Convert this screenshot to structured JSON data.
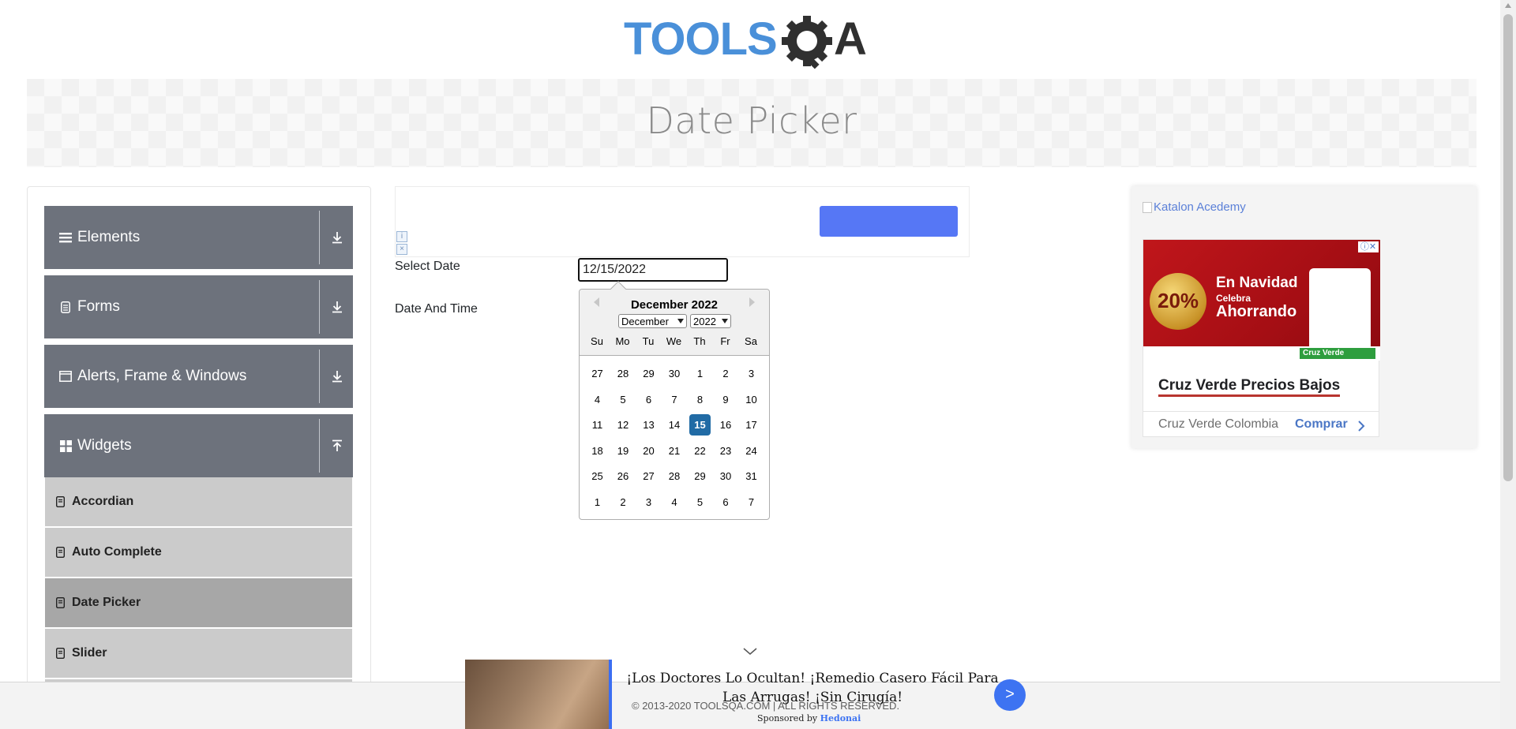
{
  "header": {
    "logo_alt": "TOOLSQA",
    "banner_title": "Date Picker"
  },
  "sidebar": {
    "groups": [
      {
        "label": "Elements",
        "icon": "hamburger-icon",
        "expanded": false
      },
      {
        "label": "Forms",
        "icon": "document-icon",
        "expanded": false
      },
      {
        "label": "Alerts, Frame & Windows",
        "icon": "window-icon",
        "expanded": false
      },
      {
        "label": "Widgets",
        "icon": "grid-icon",
        "expanded": true
      }
    ],
    "widget_items": [
      {
        "label": "Accordian",
        "active": false
      },
      {
        "label": "Auto Complete",
        "active": false
      },
      {
        "label": "Date Picker",
        "active": true
      },
      {
        "label": "Slider",
        "active": false
      }
    ]
  },
  "form": {
    "select_date_label": "Select Date",
    "select_date_value": "12/15/2022",
    "date_time_label": "Date And Time"
  },
  "calendar": {
    "month_label": "December 2022",
    "month_select": "December",
    "year_select": "2022",
    "weekdays": [
      "Su",
      "Mo",
      "Tu",
      "We",
      "Th",
      "Fr",
      "Sa"
    ],
    "weeks": [
      [
        "27",
        "28",
        "29",
        "30",
        "1",
        "2",
        "3"
      ],
      [
        "4",
        "5",
        "6",
        "7",
        "8",
        "9",
        "10"
      ],
      [
        "11",
        "12",
        "13",
        "14",
        "15",
        "16",
        "17"
      ],
      [
        "18",
        "19",
        "20",
        "21",
        "22",
        "23",
        "24"
      ],
      [
        "25",
        "26",
        "27",
        "28",
        "29",
        "30",
        "31"
      ],
      [
        "1",
        "2",
        "3",
        "4",
        "5",
        "6",
        "7"
      ]
    ],
    "selected_day": "15"
  },
  "ad_right": {
    "link_text": "Katalon Acedemy",
    "headline": "Cruz Verde Precios Bajos",
    "source": "Cruz Verde Colombia",
    "cta": "Comprar",
    "image": {
      "percent": "20%",
      "line1": "En Navidad",
      "line2": "Celebra",
      "line3": "Ahorrando",
      "brand": "Cruz Verde"
    }
  },
  "footer": {
    "copyright": "© 2013-2020 TOOLSQA.COM | ALL RIGHTS RESERVED."
  },
  "sticky_ad": {
    "text": "¡Los Doctores Lo Ocultan! ¡Remedio Casero Fácil Para Las Arrugas! ¡Sin Cirugía!",
    "button": ">",
    "sponsored_prefix": "Sponsored by",
    "sponsored_brand": "Hedonai"
  },
  "colors": {
    "sidebar_header": "#6d727c",
    "sidebar_item": "#cbcbcb",
    "sidebar_item_active": "#a7a7a7",
    "selected_day": "#216ba5",
    "logo_blue": "#4a90d9",
    "logo_dark": "#303030"
  }
}
